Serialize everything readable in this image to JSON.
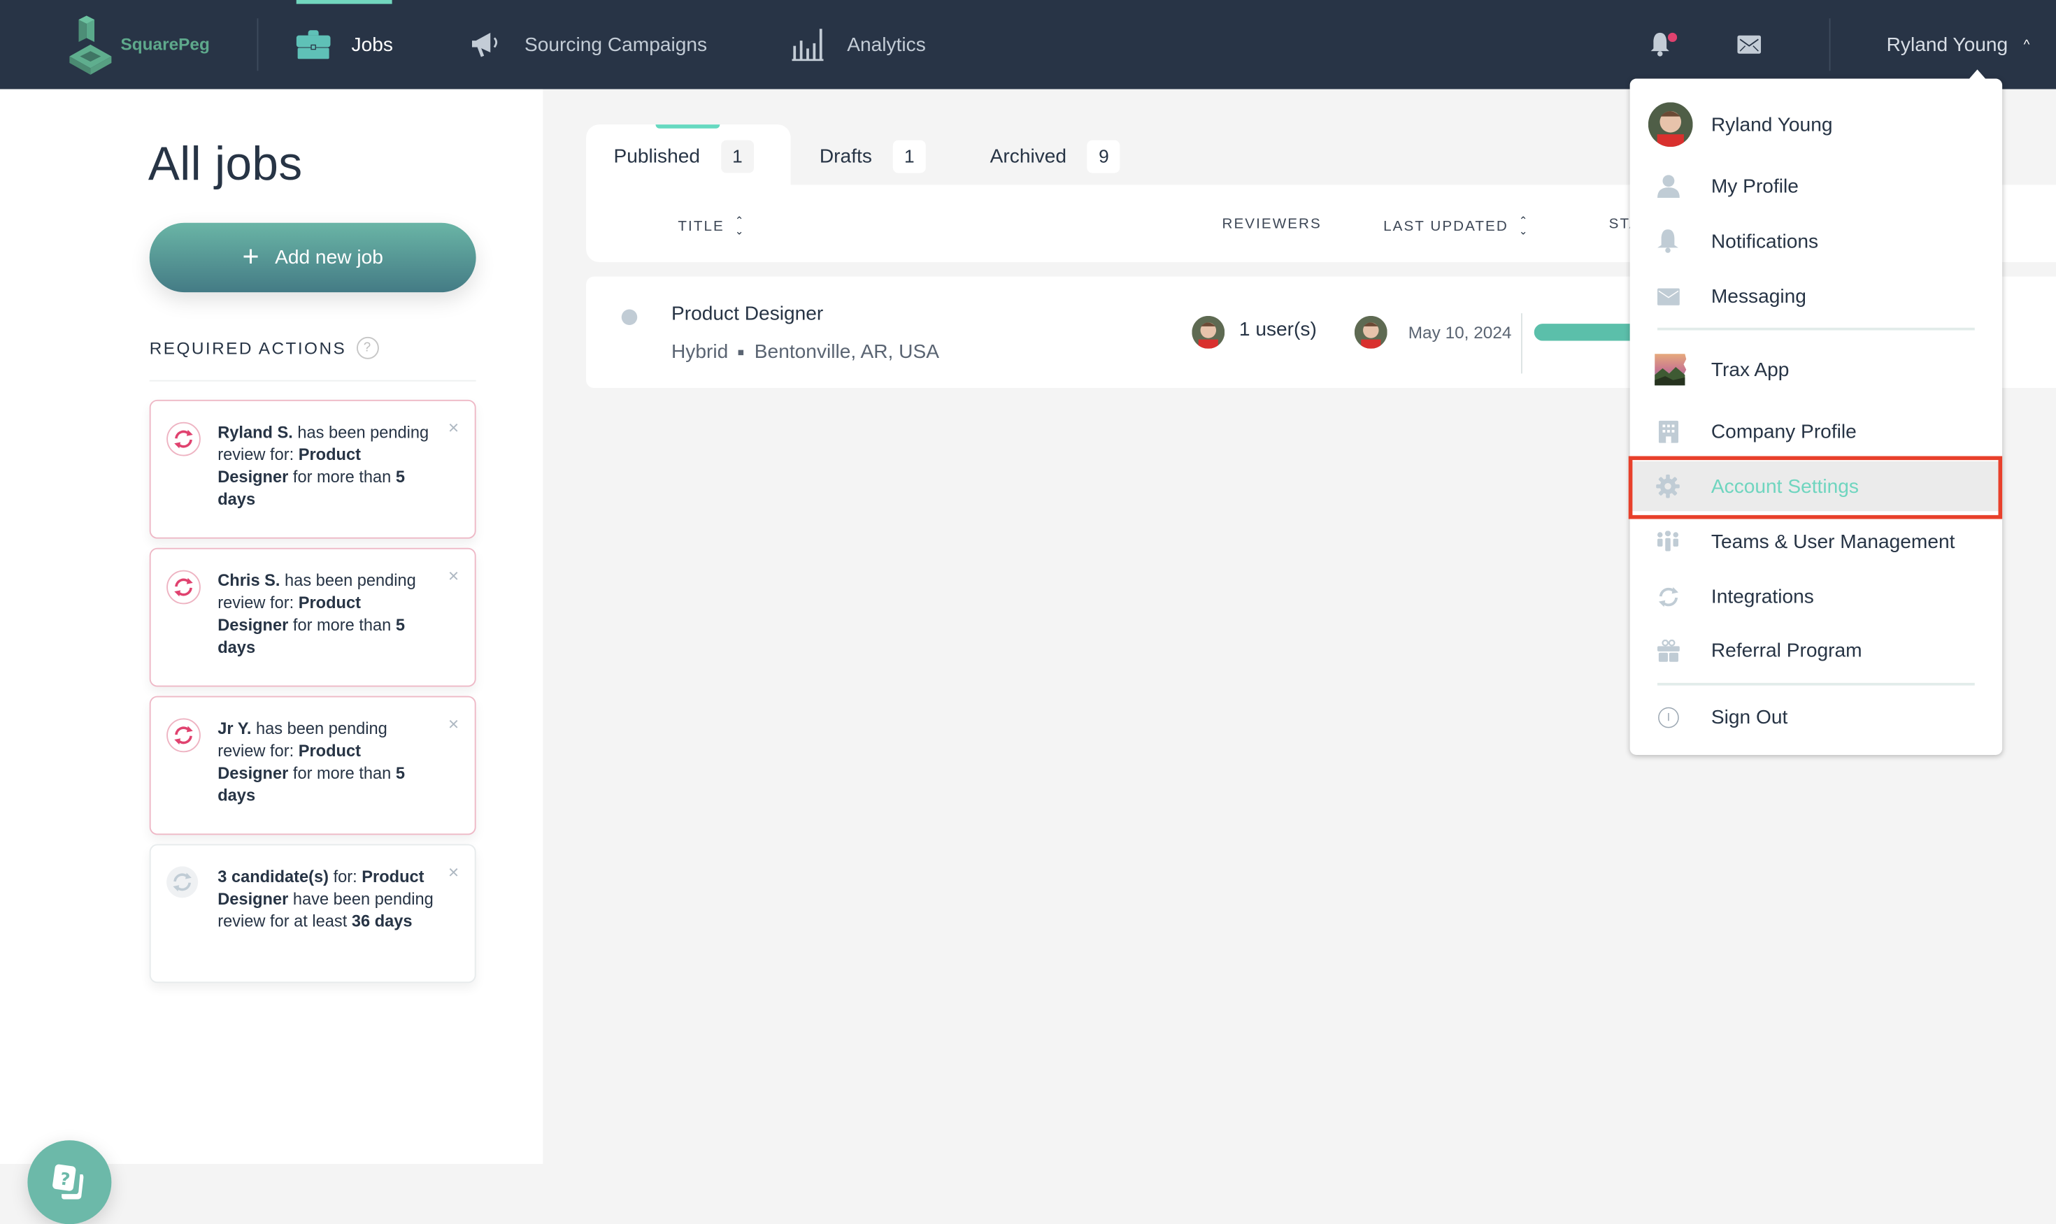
{
  "brand": {
    "name": "SquarePeg",
    "accent": "#72d6be"
  },
  "nav": {
    "items": [
      {
        "label": "Jobs",
        "icon": "briefcase-icon",
        "active": true
      },
      {
        "label": "Sourcing Campaigns",
        "icon": "megaphone-icon",
        "active": false
      },
      {
        "label": "Analytics",
        "icon": "bar-chart-icon",
        "active": false
      }
    ],
    "notifications_icon": "bell-icon",
    "notifications_unread": true,
    "messages_icon": "envelope-icon",
    "user_name": "Ryland Young",
    "user_chevron": "^"
  },
  "left": {
    "title": "All jobs",
    "add_button": {
      "icon": "+",
      "label": "Add new job"
    },
    "required_actions_title": "REQUIRED ACTIONS",
    "help_icon": "?",
    "cards": [
      {
        "severity": "alert",
        "parts": [
          {
            "t": "Ryland S.",
            "b": true
          },
          {
            "t": " has been pending review for: ",
            "b": false
          },
          {
            "t": "Product Designer",
            "b": true
          },
          {
            "t": " for more than ",
            "b": false
          },
          {
            "t": "5 days",
            "b": true
          }
        ]
      },
      {
        "severity": "alert",
        "parts": [
          {
            "t": "Chris S.",
            "b": true
          },
          {
            "t": " has been pending review for: ",
            "b": false
          },
          {
            "t": "Product Designer",
            "b": true
          },
          {
            "t": " for more than ",
            "b": false
          },
          {
            "t": "5 days",
            "b": true
          }
        ]
      },
      {
        "severity": "alert",
        "parts": [
          {
            "t": "Jr Y.",
            "b": true
          },
          {
            "t": " has been pending review for: ",
            "b": false
          },
          {
            "t": "Product Designer",
            "b": true
          },
          {
            "t": " for more than ",
            "b": false
          },
          {
            "t": "5 days",
            "b": true
          }
        ]
      },
      {
        "severity": "neutral",
        "parts": [
          {
            "t": "3 candidate(s)",
            "b": true
          },
          {
            "t": " for: ",
            "b": false
          },
          {
            "t": "Product Designer",
            "b": true
          },
          {
            "t": " have been pending review for at least ",
            "b": false
          },
          {
            "t": "36 days",
            "b": true
          }
        ]
      }
    ],
    "close_glyph": "×"
  },
  "tabs": [
    {
      "label": "Published",
      "count": "1",
      "active": true
    },
    {
      "label": "Drafts",
      "count": "1",
      "active": false
    },
    {
      "label": "Archived",
      "count": "9",
      "active": false
    }
  ],
  "table": {
    "columns": {
      "title": "TITLE",
      "reviewers": "REVIEWERS",
      "last_updated": "LAST UPDATED",
      "status_partial": "STA"
    },
    "rows": [
      {
        "title": "Product Designer",
        "workplace": "Hybrid",
        "location": "Bentonville, AR, USA",
        "reviewers": "1 user(s)",
        "last_updated": "May 10, 2024",
        "status_color": "#5bbfaa"
      }
    ]
  },
  "dropdown": {
    "profile_name": "Ryland Young",
    "items": [
      {
        "label": "My Profile",
        "icon": "person-icon"
      },
      {
        "label": "Notifications",
        "icon": "bell-icon"
      },
      {
        "label": "Messaging",
        "icon": "envelope-icon"
      },
      {
        "label": "Trax App",
        "icon": "company-logo-icon"
      },
      {
        "label": "Company Profile",
        "icon": "building-icon"
      },
      {
        "label": "Account Settings",
        "icon": "gear-icon",
        "highlighted": true
      },
      {
        "label": "Teams & User Management",
        "icon": "team-icon"
      },
      {
        "label": "Integrations",
        "icon": "sync-icon"
      },
      {
        "label": "Referral Program",
        "icon": "gift-icon"
      },
      {
        "label": "Sign Out",
        "icon": "power-icon"
      }
    ]
  }
}
